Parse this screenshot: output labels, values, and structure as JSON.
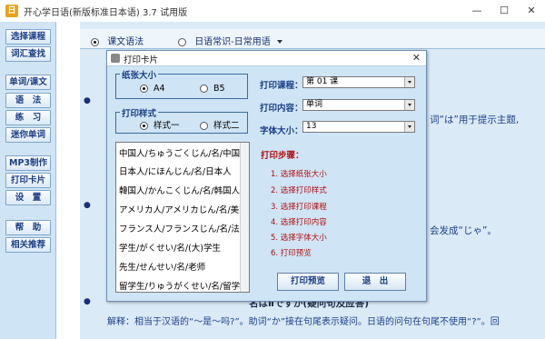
{
  "app": {
    "title": "开心学日语(新版标准日本语) 3.7 试用版",
    "icon_text": "日"
  },
  "window_controls": {
    "minimize": "—",
    "maximize": "☐",
    "close": "✕"
  },
  "sidebar": {
    "items": [
      {
        "label": "选择课程"
      },
      {
        "label": "词汇查找"
      },
      {
        "label": "单词/课文"
      },
      {
        "label": "语　法"
      },
      {
        "label": "练　习"
      },
      {
        "label": "迷你单词"
      },
      {
        "label": "MP3制作"
      },
      {
        "label": "打印卡片"
      },
      {
        "label": "设　置"
      },
      {
        "label": "帮　助"
      },
      {
        "label": "相关推荐"
      }
    ]
  },
  "top_options": {
    "opt1": "课文语法",
    "opt2": "日语常识-日常用语"
  },
  "background_text": {
    "line1": "词“は”用于提示主题,",
    "line2": "会发成“じゃ”。",
    "bullet3": "名はⅡですか(疑问句及应答)",
    "explain": "解释：相当于汉语的“～是～吗?”。助词“か”接在句尾表示疑问。日语的问句在句尾不使用“?”。回"
  },
  "dialog": {
    "title": "打印卡片",
    "close": "✕",
    "paper_group": {
      "title": "纸张大小",
      "opt_a4": "A4",
      "opt_b5": "B5"
    },
    "style_group": {
      "title": "打印样式",
      "opt1": "样式一",
      "opt2": "样式二"
    },
    "list_items": [
      "中国人/ちゅうごくじん/名/中国",
      "日本人/にほんじん/名/日本人",
      "韓国人/かんこくじん/名/韩国人",
      "アメリカ人/アメリカじん/名/美国",
      "フランス人/フランスじん/名/法国",
      "学生/がくせい/名/(大)学生",
      "先生/せんせい/名/老师",
      "留学生/りゅうがくせい/名/留学生"
    ],
    "course_label": "打印课程：",
    "course_value": "第 01 课",
    "content_label": "打印内容：",
    "content_value": "单词",
    "font_label": "字体大小：",
    "font_value": "13",
    "steps_title": "打印步骤：",
    "steps": [
      "1. 选择纸张大小",
      "2. 选择打印样式",
      "3. 选择打印课程",
      "4. 选择打印内容",
      "5. 选择字体大小",
      "6. 打印预览"
    ],
    "preview_button": "打印预览",
    "exit_button": "退　出"
  }
}
